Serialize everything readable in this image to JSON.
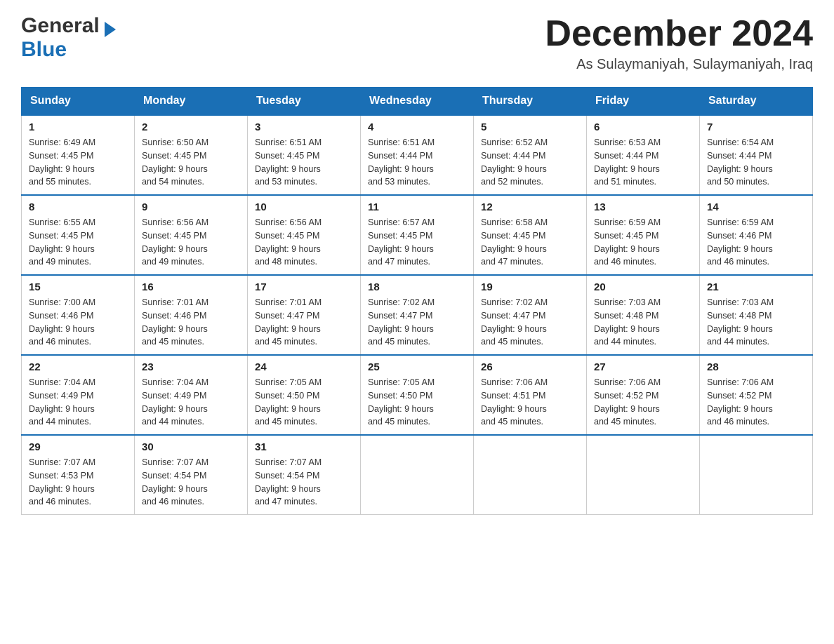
{
  "header": {
    "logo_general": "General",
    "logo_blue": "Blue",
    "month_title": "December 2024",
    "location": "As Sulaymaniyah, Sulaymaniyah, Iraq"
  },
  "days_of_week": [
    "Sunday",
    "Monday",
    "Tuesday",
    "Wednesday",
    "Thursday",
    "Friday",
    "Saturday"
  ],
  "weeks": [
    [
      {
        "day": "1",
        "sunrise": "6:49 AM",
        "sunset": "4:45 PM",
        "daylight": "9 hours and 55 minutes."
      },
      {
        "day": "2",
        "sunrise": "6:50 AM",
        "sunset": "4:45 PM",
        "daylight": "9 hours and 54 minutes."
      },
      {
        "day": "3",
        "sunrise": "6:51 AM",
        "sunset": "4:45 PM",
        "daylight": "9 hours and 53 minutes."
      },
      {
        "day": "4",
        "sunrise": "6:51 AM",
        "sunset": "4:44 PM",
        "daylight": "9 hours and 53 minutes."
      },
      {
        "day": "5",
        "sunrise": "6:52 AM",
        "sunset": "4:44 PM",
        "daylight": "9 hours and 52 minutes."
      },
      {
        "day": "6",
        "sunrise": "6:53 AM",
        "sunset": "4:44 PM",
        "daylight": "9 hours and 51 minutes."
      },
      {
        "day": "7",
        "sunrise": "6:54 AM",
        "sunset": "4:44 PM",
        "daylight": "9 hours and 50 minutes."
      }
    ],
    [
      {
        "day": "8",
        "sunrise": "6:55 AM",
        "sunset": "4:45 PM",
        "daylight": "9 hours and 49 minutes."
      },
      {
        "day": "9",
        "sunrise": "6:56 AM",
        "sunset": "4:45 PM",
        "daylight": "9 hours and 49 minutes."
      },
      {
        "day": "10",
        "sunrise": "6:56 AM",
        "sunset": "4:45 PM",
        "daylight": "9 hours and 48 minutes."
      },
      {
        "day": "11",
        "sunrise": "6:57 AM",
        "sunset": "4:45 PM",
        "daylight": "9 hours and 47 minutes."
      },
      {
        "day": "12",
        "sunrise": "6:58 AM",
        "sunset": "4:45 PM",
        "daylight": "9 hours and 47 minutes."
      },
      {
        "day": "13",
        "sunrise": "6:59 AM",
        "sunset": "4:45 PM",
        "daylight": "9 hours and 46 minutes."
      },
      {
        "day": "14",
        "sunrise": "6:59 AM",
        "sunset": "4:46 PM",
        "daylight": "9 hours and 46 minutes."
      }
    ],
    [
      {
        "day": "15",
        "sunrise": "7:00 AM",
        "sunset": "4:46 PM",
        "daylight": "9 hours and 46 minutes."
      },
      {
        "day": "16",
        "sunrise": "7:01 AM",
        "sunset": "4:46 PM",
        "daylight": "9 hours and 45 minutes."
      },
      {
        "day": "17",
        "sunrise": "7:01 AM",
        "sunset": "4:47 PM",
        "daylight": "9 hours and 45 minutes."
      },
      {
        "day": "18",
        "sunrise": "7:02 AM",
        "sunset": "4:47 PM",
        "daylight": "9 hours and 45 minutes."
      },
      {
        "day": "19",
        "sunrise": "7:02 AM",
        "sunset": "4:47 PM",
        "daylight": "9 hours and 45 minutes."
      },
      {
        "day": "20",
        "sunrise": "7:03 AM",
        "sunset": "4:48 PM",
        "daylight": "9 hours and 44 minutes."
      },
      {
        "day": "21",
        "sunrise": "7:03 AM",
        "sunset": "4:48 PM",
        "daylight": "9 hours and 44 minutes."
      }
    ],
    [
      {
        "day": "22",
        "sunrise": "7:04 AM",
        "sunset": "4:49 PM",
        "daylight": "9 hours and 44 minutes."
      },
      {
        "day": "23",
        "sunrise": "7:04 AM",
        "sunset": "4:49 PM",
        "daylight": "9 hours and 44 minutes."
      },
      {
        "day": "24",
        "sunrise": "7:05 AM",
        "sunset": "4:50 PM",
        "daylight": "9 hours and 45 minutes."
      },
      {
        "day": "25",
        "sunrise": "7:05 AM",
        "sunset": "4:50 PM",
        "daylight": "9 hours and 45 minutes."
      },
      {
        "day": "26",
        "sunrise": "7:06 AM",
        "sunset": "4:51 PM",
        "daylight": "9 hours and 45 minutes."
      },
      {
        "day": "27",
        "sunrise": "7:06 AM",
        "sunset": "4:52 PM",
        "daylight": "9 hours and 45 minutes."
      },
      {
        "day": "28",
        "sunrise": "7:06 AM",
        "sunset": "4:52 PM",
        "daylight": "9 hours and 46 minutes."
      }
    ],
    [
      {
        "day": "29",
        "sunrise": "7:07 AM",
        "sunset": "4:53 PM",
        "daylight": "9 hours and 46 minutes."
      },
      {
        "day": "30",
        "sunrise": "7:07 AM",
        "sunset": "4:54 PM",
        "daylight": "9 hours and 46 minutes."
      },
      {
        "day": "31",
        "sunrise": "7:07 AM",
        "sunset": "4:54 PM",
        "daylight": "9 hours and 47 minutes."
      },
      null,
      null,
      null,
      null
    ]
  ],
  "labels": {
    "sunrise": "Sunrise:",
    "sunset": "Sunset:",
    "daylight": "Daylight:"
  }
}
